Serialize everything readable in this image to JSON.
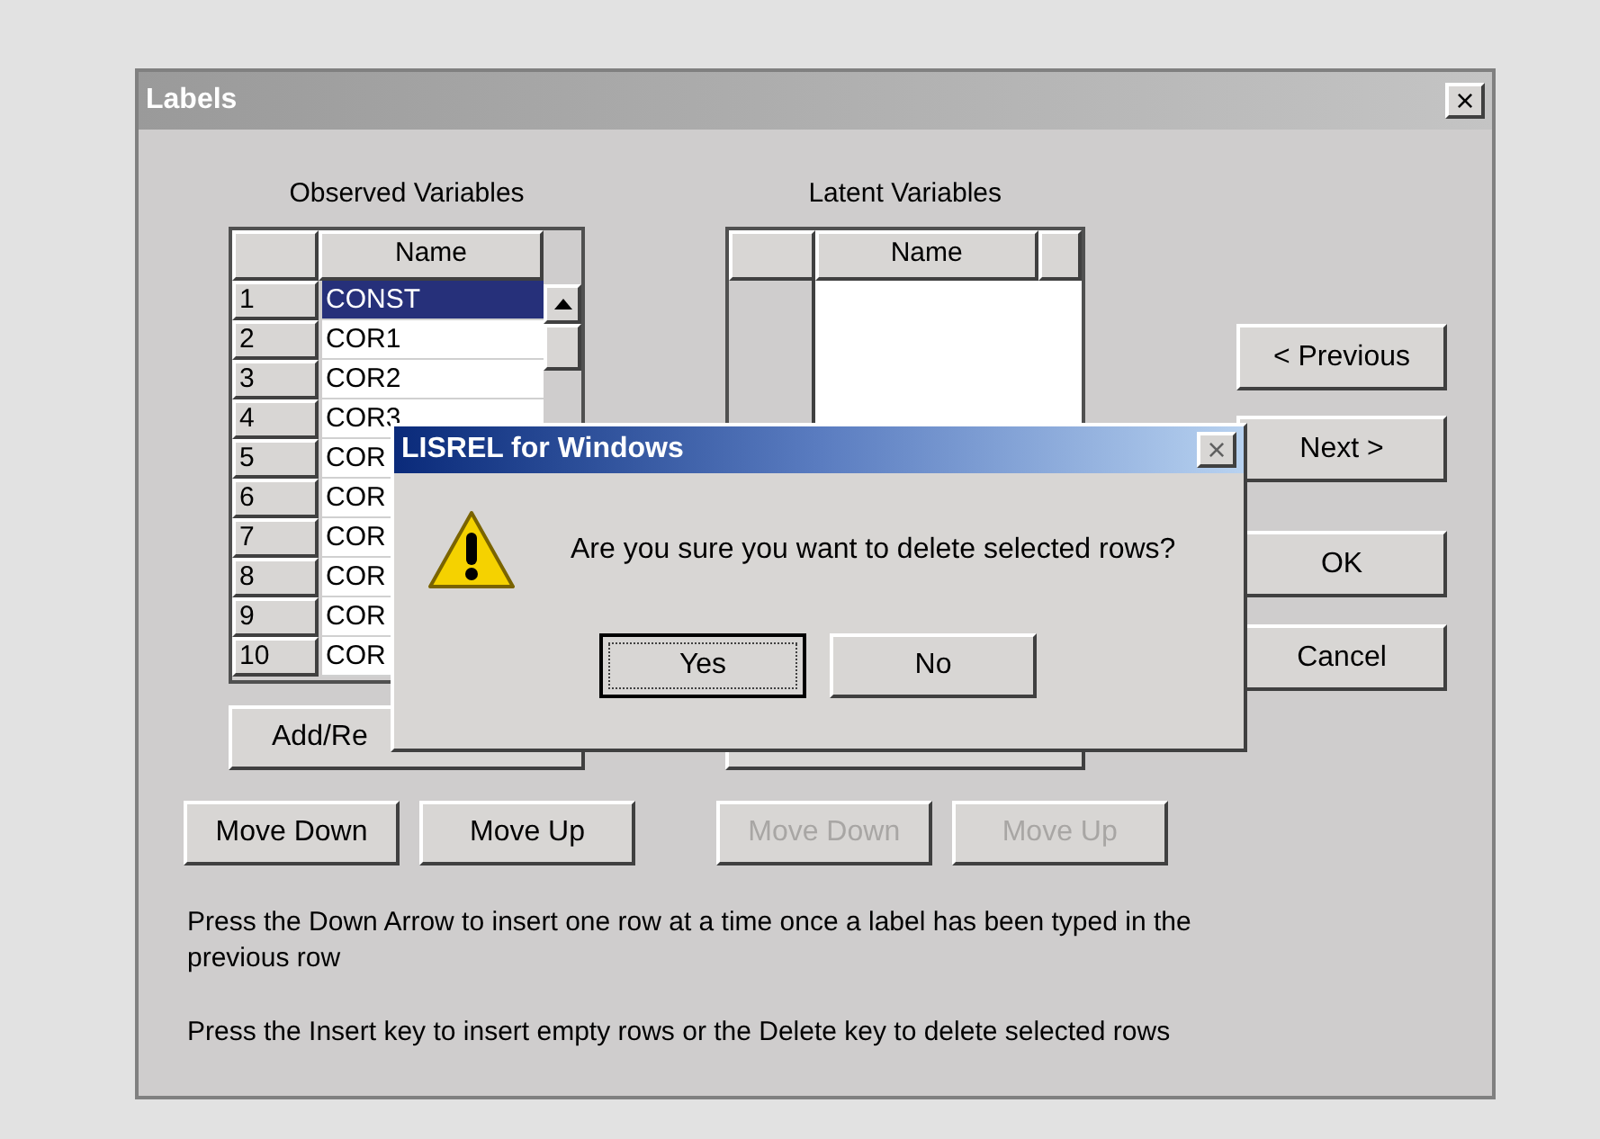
{
  "window": {
    "title": "Labels",
    "close": "×"
  },
  "observed": {
    "title": "Observed Variables",
    "columns": [
      "Name"
    ],
    "rows": [
      {
        "number": "1",
        "name": "CONST",
        "selected": true
      },
      {
        "number": "2",
        "name": "COR1",
        "selected": false
      },
      {
        "number": "3",
        "name": "COR2",
        "selected": false
      },
      {
        "number": "4",
        "name": "COR3",
        "selected": false
      },
      {
        "number": "5",
        "name": "COR",
        "selected": false
      },
      {
        "number": "6",
        "name": "COR",
        "selected": false
      },
      {
        "number": "7",
        "name": "COR",
        "selected": false
      },
      {
        "number": "8",
        "name": "COR",
        "selected": false
      },
      {
        "number": "9",
        "name": "COR",
        "selected": false
      },
      {
        "number": "10",
        "name": "COR",
        "selected": false
      }
    ],
    "button": "Add/Re",
    "move_buttons": [
      {
        "label": "Move Down",
        "disabled": false
      },
      {
        "label": "Move Up",
        "disabled": false
      }
    ]
  },
  "latent": {
    "title": "Latent Variables",
    "columns": [
      "Name"
    ],
    "move_buttons": [
      {
        "label": "Move Down",
        "disabled": true
      },
      {
        "label": "Move Up",
        "disabled": true
      }
    ]
  },
  "nav_buttons": [
    "< Previous",
    "Next >",
    "OK",
    "Cancel"
  ],
  "hints": [
    "Press the Down Arrow to insert one row at a time once a label has been typed in the previous row",
    "Press the Insert key to insert empty rows or the Delete key to delete selected rows"
  ],
  "dialog": {
    "title": "LISREL for Windows",
    "close": "×",
    "message": "Are you sure you want to delete selected rows?",
    "buttons": [
      {
        "label": "Yes",
        "default": true
      },
      {
        "label": "No",
        "default": false
      }
    ]
  }
}
